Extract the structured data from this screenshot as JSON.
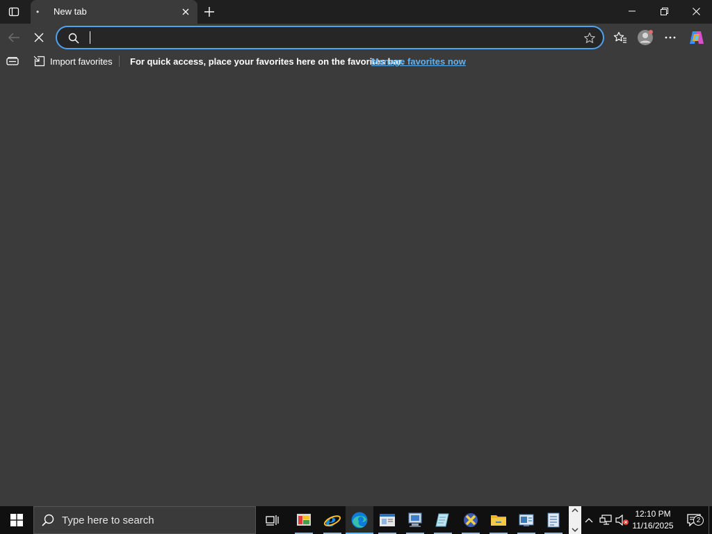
{
  "browser": {
    "tab": {
      "title": "New tab",
      "loading_dot": "•"
    },
    "address_bar": {
      "value": "",
      "placeholder": ""
    },
    "favorites_bar": {
      "import_label": "Import favorites",
      "message": "For quick access, place your favorites here on the favorites bar.",
      "manage_link": "Manage favorites now"
    },
    "icons": {
      "tab_actions": "tab-actions-icon",
      "tab_close": "close-icon",
      "new_tab": "plus-icon",
      "minimize": "minimize-icon",
      "restore": "restore-icon",
      "close_window": "close-icon",
      "back": "back-arrow-icon",
      "stop": "stop-icon",
      "search": "search-icon",
      "favorite_star": "star-icon",
      "favorites": "favorites-icon",
      "profile": "profile-icon",
      "more": "more-icon",
      "copilot": "copilot-icon"
    },
    "colors": {
      "accent": "#4fa3f0",
      "link": "#5eb3f6",
      "background": "#3b3b3b",
      "titlebar": "#1f1f1f"
    }
  },
  "taskbar": {
    "search_placeholder": "Type here to search",
    "apps": [
      {
        "name": "Task View",
        "icon": "task-view-icon"
      },
      {
        "name": "Control Panel",
        "icon": "control-panel-icon"
      },
      {
        "name": "Internet Explorer",
        "icon": "internet-explorer-icon"
      },
      {
        "name": "Microsoft Edge",
        "icon": "edge-icon",
        "active": true
      },
      {
        "name": "Window App",
        "icon": "window-app-icon"
      },
      {
        "name": "Network Monitor",
        "icon": "monitor-app-icon"
      },
      {
        "name": "Notepad",
        "icon": "notepad-icon"
      },
      {
        "name": "Tool",
        "icon": "x-tool-icon"
      },
      {
        "name": "File Explorer",
        "icon": "folder-icon"
      },
      {
        "name": "System Info",
        "icon": "system-app-icon"
      },
      {
        "name": "Document App",
        "icon": "document-app-icon"
      }
    ],
    "tray": {
      "time": "12:10 PM",
      "date": "11/16/2025",
      "notification_count": "2",
      "icons": [
        "show-hidden-icons-icon",
        "network-icon",
        "volume-muted-icon",
        "notification-icon"
      ]
    }
  }
}
